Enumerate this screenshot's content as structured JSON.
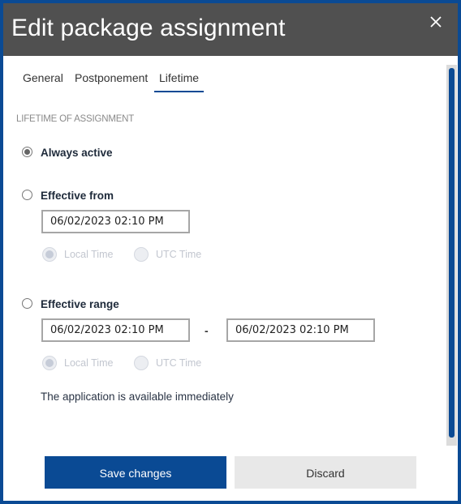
{
  "dialog": {
    "title": "Edit package assignment",
    "close_icon": "close-icon"
  },
  "tabs": [
    {
      "label": "General",
      "active": false
    },
    {
      "label": "Postponement",
      "active": false
    },
    {
      "label": "Lifetime",
      "active": true
    }
  ],
  "lifetime": {
    "section_label": "LIFETIME OF ASSIGNMENT",
    "options": [
      {
        "label": "Always active",
        "selected": true
      },
      {
        "label": "Effective from",
        "selected": false
      },
      {
        "label": "Effective range",
        "selected": false
      }
    ],
    "effective_from": {
      "value": "06/02/2023 02:10 PM",
      "timezone": {
        "local_label": "Local Time",
        "utc_label": "UTC Time",
        "selected": "Local Time"
      }
    },
    "effective_range": {
      "start_value": "06/02/2023 02:10 PM",
      "separator": "-",
      "end_value": "06/02/2023 02:10 PM",
      "timezone": {
        "local_label": "Local Time",
        "utc_label": "UTC Time",
        "selected": "Local Time"
      }
    },
    "info_text": "The application is available immediately"
  },
  "footer": {
    "save_label": "Save changes",
    "discard_label": "Discard"
  },
  "colors": {
    "accent": "#0a4a94",
    "header_bg": "#505050",
    "discard_bg": "#e8e8e8"
  }
}
